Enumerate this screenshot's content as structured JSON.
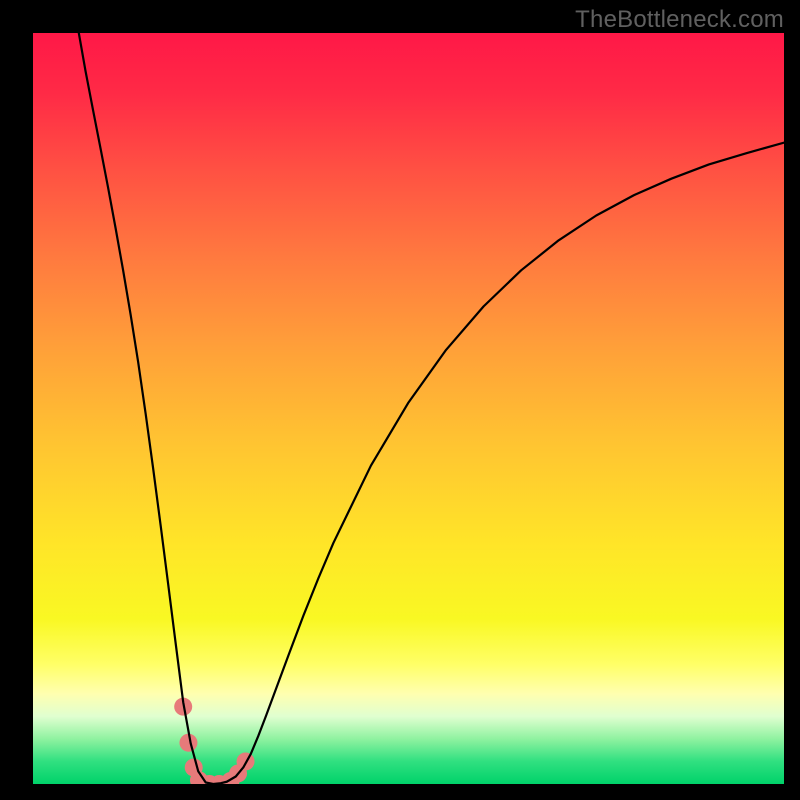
{
  "watermark": "TheBottleneck.com",
  "chart_data": {
    "type": "line",
    "title": "",
    "xlabel": "",
    "ylabel": "",
    "xlim": [
      0,
      100
    ],
    "ylim": [
      0,
      100
    ],
    "grid": false,
    "legend": false,
    "annotations": [],
    "series": [
      {
        "name": "bottleneck-curve",
        "color": "#000000",
        "x": [
          6.1,
          7.0,
          8.0,
          9.0,
          10.0,
          11.0,
          12.0,
          13.0,
          14.0,
          15.0,
          16.0,
          17.0,
          18.0,
          19.0,
          20.0,
          21.0,
          22.0,
          23.0,
          24.0,
          25.0,
          25.8,
          27.0,
          28.0,
          29.0,
          30.0,
          31.0,
          32.0,
          34.0,
          36.0,
          38.0,
          40.0,
          45.0,
          50.0,
          55.0,
          60.0,
          65.0,
          70.0,
          75.0,
          80.0,
          85.0,
          90.0,
          95.0,
          100.0
        ],
        "values": [
          100.0,
          94.9,
          89.7,
          84.6,
          79.4,
          74.0,
          68.4,
          62.5,
          56.2,
          49.3,
          42.0,
          34.4,
          26.6,
          18.7,
          10.9,
          5.4,
          1.7,
          0.2,
          0.0,
          0.1,
          0.3,
          1.0,
          2.2,
          4.0,
          6.4,
          9.0,
          11.7,
          17.1,
          22.4,
          27.4,
          32.1,
          42.4,
          50.8,
          57.8,
          63.6,
          68.4,
          72.4,
          75.7,
          78.4,
          80.6,
          82.5,
          84.0,
          85.4
        ]
      }
    ],
    "markers": [
      {
        "x": 20.0,
        "y": 10.3,
        "color": "#e77a7a",
        "r": 9
      },
      {
        "x": 20.7,
        "y": 5.5,
        "color": "#e77a7a",
        "r": 9
      },
      {
        "x": 21.4,
        "y": 2.2,
        "color": "#e77a7a",
        "r": 9
      },
      {
        "x": 22.1,
        "y": 0.5,
        "color": "#e77a7a",
        "r": 9
      },
      {
        "x": 23.5,
        "y": 0.0,
        "color": "#e77a7a",
        "r": 9
      },
      {
        "x": 24.8,
        "y": 0.0,
        "color": "#e77a7a",
        "r": 9
      },
      {
        "x": 26.3,
        "y": 0.4,
        "color": "#e77a7a",
        "r": 9
      },
      {
        "x": 27.3,
        "y": 1.4,
        "color": "#e77a7a",
        "r": 9
      },
      {
        "x": 28.3,
        "y": 3.0,
        "color": "#e77a7a",
        "r": 9
      }
    ],
    "background_gradient": {
      "top_color": "#ff1847",
      "stops": [
        {
          "offset": 0.0,
          "color": "#ff1847"
        },
        {
          "offset": 0.08,
          "color": "#ff2a46"
        },
        {
          "offset": 0.18,
          "color": "#ff5043"
        },
        {
          "offset": 0.3,
          "color": "#ff7a3f"
        },
        {
          "offset": 0.42,
          "color": "#ffa039"
        },
        {
          "offset": 0.55,
          "color": "#ffc531"
        },
        {
          "offset": 0.68,
          "color": "#ffe528"
        },
        {
          "offset": 0.78,
          "color": "#f9f823"
        },
        {
          "offset": 0.84,
          "color": "#ffff66"
        },
        {
          "offset": 0.88,
          "color": "#ffffb0"
        },
        {
          "offset": 0.91,
          "color": "#e0ffd0"
        },
        {
          "offset": 0.94,
          "color": "#8ff2a0"
        },
        {
          "offset": 0.97,
          "color": "#30e080"
        },
        {
          "offset": 1.0,
          "color": "#00d26a"
        }
      ]
    }
  }
}
